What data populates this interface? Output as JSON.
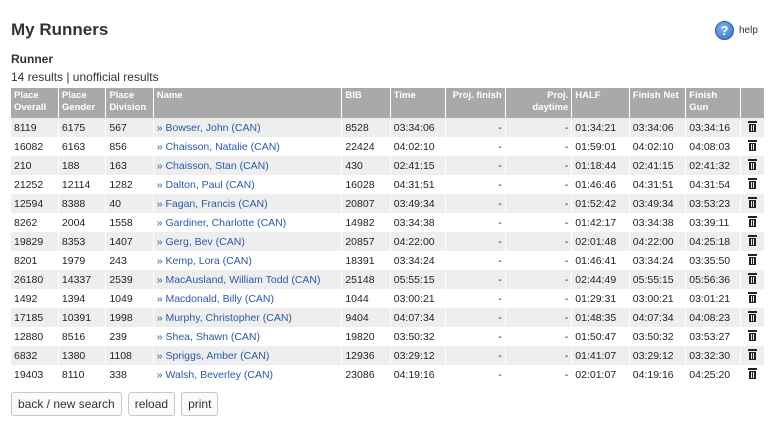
{
  "page": {
    "title": "My Runners",
    "help_label": "help"
  },
  "section": {
    "title": "Runner",
    "summary": "14 results | unofficial results"
  },
  "table": {
    "headers": [
      "Place Overall",
      "Place Gender",
      "Place Division",
      "Name",
      "BIB",
      "Time",
      "Proj. finish",
      "Proj. daytime",
      "HALF",
      "Finish Net",
      "Finish Gun",
      ""
    ],
    "rows": [
      [
        "8119",
        "6175",
        "567",
        "» Bowser, John (CAN)",
        "8528",
        "03:34:06",
        "-",
        "-",
        "01:34:21",
        "03:34:06",
        "03:34:16"
      ],
      [
        "16082",
        "6163",
        "856",
        "» Chaisson, Natalie (CAN)",
        "22424",
        "04:02:10",
        "-",
        "-",
        "01:59:01",
        "04:02:10",
        "04:08:03"
      ],
      [
        "210",
        "188",
        "163",
        "» Chaisson, Stan (CAN)",
        "430",
        "02:41:15",
        "-",
        "-",
        "01:18:44",
        "02:41:15",
        "02:41:32"
      ],
      [
        "21252",
        "12114",
        "1282",
        "» Dalton, Paul (CAN)",
        "16028",
        "04:31:51",
        "-",
        "-",
        "01:46:46",
        "04:31:51",
        "04:31:54"
      ],
      [
        "12594",
        "8388",
        "40",
        "» Fagan, Francis (CAN)",
        "20807",
        "03:49:34",
        "-",
        "-",
        "01:52:42",
        "03:49:34",
        "03:53:23"
      ],
      [
        "8262",
        "2004",
        "1558",
        "» Gardiner, Charlotte (CAN)",
        "14982",
        "03:34:38",
        "-",
        "-",
        "01:42:17",
        "03:34:38",
        "03:39:11"
      ],
      [
        "19829",
        "8353",
        "1407",
        "» Gerg, Bev (CAN)",
        "20857",
        "04:22:00",
        "-",
        "-",
        "02:01:48",
        "04:22:00",
        "04:25:18"
      ],
      [
        "8201",
        "1979",
        "243",
        "» Kemp, Lora (CAN)",
        "18391",
        "03:34:24",
        "-",
        "-",
        "01:46:41",
        "03:34:24",
        "03:35:50"
      ],
      [
        "26180",
        "14337",
        "2539",
        "» MacAusland, William Todd (CAN)",
        "25148",
        "05:55:15",
        "-",
        "-",
        "02:44:49",
        "05:55:15",
        "05:56:36"
      ],
      [
        "1492",
        "1394",
        "1049",
        "» Macdonald, Billy (CAN)",
        "1044",
        "03:00:21",
        "-",
        "-",
        "01:29:31",
        "03:00:21",
        "03:01:21"
      ],
      [
        "17185",
        "10391",
        "1998",
        "» Murphy, Christopher (CAN)",
        "9404",
        "04:07:34",
        "-",
        "-",
        "01:48:35",
        "04:07:34",
        "04:08:23"
      ],
      [
        "12880",
        "8516",
        "239",
        "» Shea, Shawn (CAN)",
        "19820",
        "03:50:32",
        "-",
        "-",
        "01:50:47",
        "03:50:32",
        "03:53:27"
      ],
      [
        "6832",
        "1380",
        "1108",
        "» Spriggs, Amber (CAN)",
        "12936",
        "03:29:12",
        "-",
        "-",
        "01:41:07",
        "03:29:12",
        "03:32:30"
      ],
      [
        "19403",
        "8110",
        "338",
        "» Walsh, Beverley (CAN)",
        "23086",
        "04:19:16",
        "-",
        "-",
        "02:01:07",
        "04:19:16",
        "04:25:20"
      ]
    ],
    "row_action_icon": "trash-icon"
  },
  "buttons": {
    "back": "back / new search",
    "reload": "reload",
    "print": "print"
  }
}
